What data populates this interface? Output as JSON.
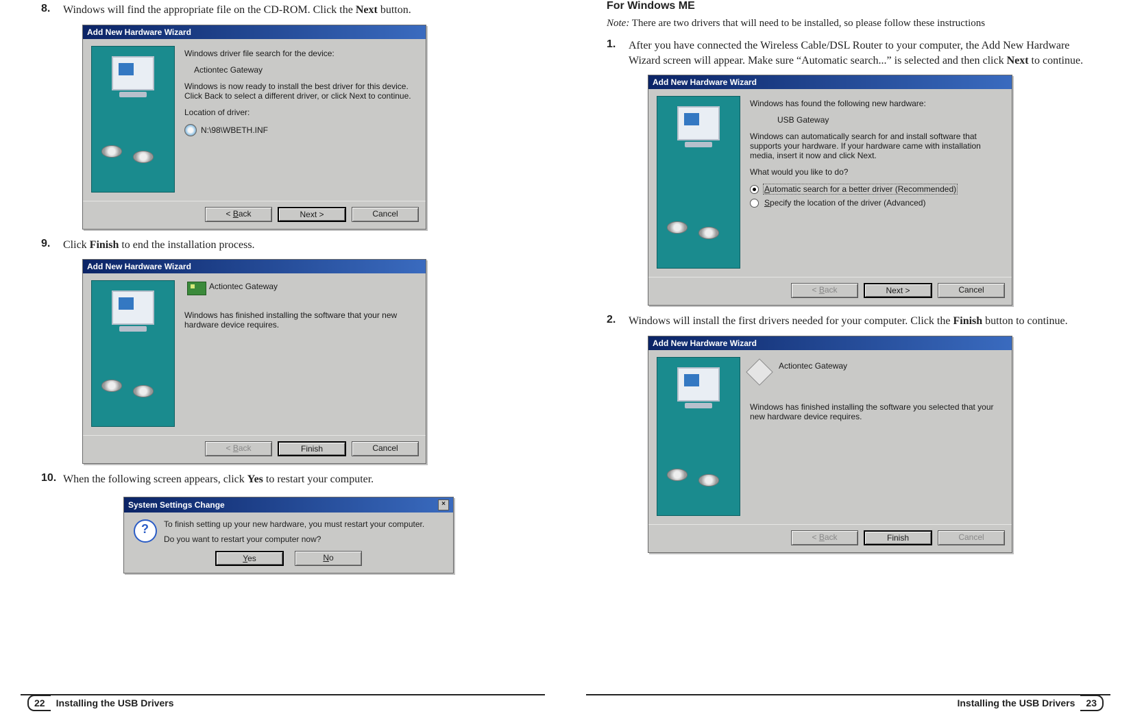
{
  "left": {
    "steps": {
      "s8": {
        "num": "8.",
        "pre": "Windows will find the appropriate file on the CD-ROM. Click the ",
        "bold": "Next",
        "post": " button."
      },
      "s9": {
        "num": "9.",
        "pre": "Click ",
        "bold": "Finish",
        "post": " to end the installation process."
      },
      "s10": {
        "num": "10.",
        "pre": "When the following screen appears, click ",
        "bold": "Yes",
        "post": " to restart your computer."
      }
    },
    "dlg1": {
      "title": "Add New Hardware Wizard",
      "line1": "Windows driver file search for the device:",
      "device": "Actiontec Gateway",
      "line2": "Windows is now ready to install the best driver for this device. Click Back to select a different driver, or click Next to continue.",
      "locLabel": "Location of driver:",
      "locValue": "N:\\98\\WBETH.INF",
      "btnBack": "< Back",
      "btnNext": "Next >",
      "btnCancel": "Cancel"
    },
    "dlg2": {
      "title": "Add New Hardware Wizard",
      "device": "Actiontec Gateway",
      "line": "Windows has finished installing the software that your new hardware device requires.",
      "btnBack": "< Back",
      "btnFinish": "Finish",
      "btnCancel": "Cancel"
    },
    "msg": {
      "title": "System Settings Change",
      "line1": "To finish setting up your new hardware, you must restart your computer.",
      "line2": "Do you want to restart your computer now?",
      "btnYes": "Yes",
      "btnNo": "No"
    },
    "footer": {
      "page": "22",
      "title": "Installing the USB Drivers"
    }
  },
  "right": {
    "heading": "For Windows ME",
    "noteLabel": "Note:",
    "noteText": " There are two drivers that will need to be installed, so please follow these instructions",
    "steps": {
      "s1": {
        "num": "1.",
        "text_a": "After you have connected the Wireless Cable/DSL Router to your computer, the Add New Hardware Wizard screen will appear. Make sure “Automatic search...” is selected and then click ",
        "bold": "Next",
        "text_b": " to continue."
      },
      "s2": {
        "num": "2.",
        "text_a": "Windows will install the first drivers needed for your computer. Click the ",
        "bold": "Finish",
        "text_b": " button to continue."
      }
    },
    "dlg1": {
      "title": "Add New Hardware Wizard",
      "foundText": "Windows has found the following new hardware:",
      "device": "USB Gateway",
      "body": "Windows can automatically search for and install software that supports your hardware. If your hardware came with installation media, insert it now and click Next.",
      "prompt": "What would you like to do?",
      "opt1": "Automatic search for a better driver (Recommended)",
      "opt2": "Specify the location of the driver (Advanced)",
      "btnBack": "< Back",
      "btnNext": "Next >",
      "btnCancel": "Cancel"
    },
    "dlg2": {
      "title": "Add New Hardware Wizard",
      "device": "Actiontec Gateway",
      "line": "Windows has finished installing the software you selected that your new hardware device requires.",
      "btnBack": "< Back",
      "btnFinish": "Finish",
      "btnCancel": "Cancel"
    },
    "footer": {
      "page": "23",
      "title": "Installing the USB Drivers"
    }
  }
}
